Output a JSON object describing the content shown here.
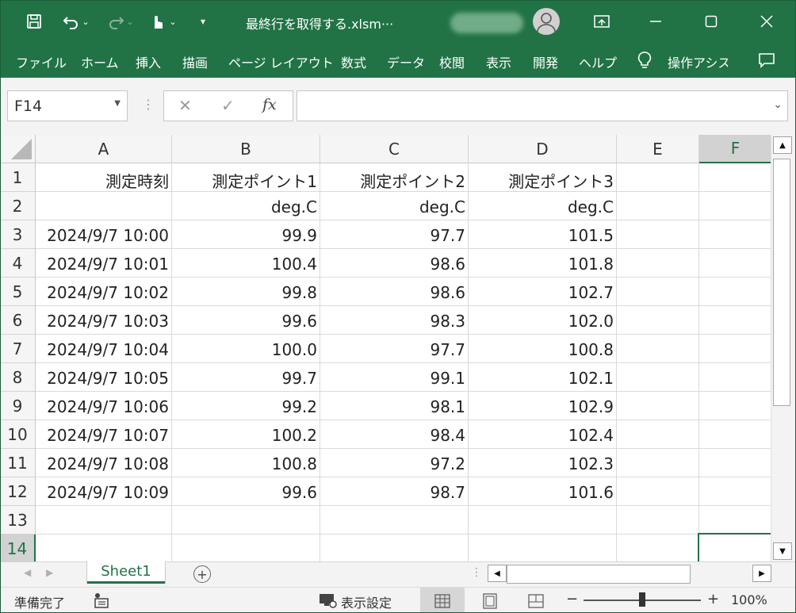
{
  "window": {
    "title": "最終行を取得する.xlsm···",
    "controls": [
      "restore-ribbon",
      "minimize",
      "maximize",
      "close"
    ]
  },
  "quick_access": {
    "icons": [
      "save-icon",
      "undo-icon",
      "redo-icon",
      "touch-mode-icon",
      "customize-icon"
    ]
  },
  "ribbon": {
    "tabs": [
      "ファイル",
      "ホーム",
      "挿入",
      "描画",
      "ページ レイアウト",
      "数式",
      "データ",
      "校閲",
      "表示",
      "開発",
      "ヘルプ"
    ],
    "tell_me": "操作アシス",
    "comments_icon": "comment-icon"
  },
  "formula_bar": {
    "name_box": "F14",
    "formula": "",
    "fx_label": "fx"
  },
  "columns": [
    "A",
    "B",
    "C",
    "D",
    "E",
    "F"
  ],
  "selected_column": "F",
  "selected_row": "14",
  "rows": [
    {
      "num": "1",
      "cells": [
        "測定時刻",
        "測定ポイント1",
        "測定ポイント2",
        "測定ポイント3",
        "",
        ""
      ]
    },
    {
      "num": "2",
      "cells": [
        "",
        "deg.C",
        "deg.C",
        "deg.C",
        "",
        ""
      ]
    },
    {
      "num": "3",
      "cells": [
        "2024/9/7 10:00",
        "99.9",
        "97.7",
        "101.5",
        "",
        ""
      ]
    },
    {
      "num": "4",
      "cells": [
        "2024/9/7 10:01",
        "100.4",
        "98.6",
        "101.8",
        "",
        ""
      ]
    },
    {
      "num": "5",
      "cells": [
        "2024/9/7 10:02",
        "99.8",
        "98.6",
        "102.7",
        "",
        ""
      ]
    },
    {
      "num": "6",
      "cells": [
        "2024/9/7 10:03",
        "99.6",
        "98.3",
        "102.0",
        "",
        ""
      ]
    },
    {
      "num": "7",
      "cells": [
        "2024/9/7 10:04",
        "100.0",
        "97.7",
        "100.8",
        "",
        ""
      ]
    },
    {
      "num": "8",
      "cells": [
        "2024/9/7 10:05",
        "99.7",
        "99.1",
        "102.1",
        "",
        ""
      ]
    },
    {
      "num": "9",
      "cells": [
        "2024/9/7 10:06",
        "99.2",
        "98.1",
        "102.9",
        "",
        ""
      ]
    },
    {
      "num": "10",
      "cells": [
        "2024/9/7 10:07",
        "100.2",
        "98.4",
        "102.4",
        "",
        ""
      ]
    },
    {
      "num": "11",
      "cells": [
        "2024/9/7 10:08",
        "100.8",
        "97.2",
        "102.3",
        "",
        ""
      ]
    },
    {
      "num": "12",
      "cells": [
        "2024/9/7 10:09",
        "99.6",
        "98.7",
        "101.6",
        "",
        ""
      ]
    },
    {
      "num": "13",
      "cells": [
        "",
        "",
        "",
        "",
        "",
        ""
      ]
    },
    {
      "num": "14",
      "cells": [
        "",
        "",
        "",
        "",
        "",
        ""
      ]
    }
  ],
  "sheets": [
    "Sheet1"
  ],
  "status": {
    "ready": "準備完了",
    "display_settings": "表示設定",
    "zoom": "100%",
    "zoom_minus": "−",
    "zoom_plus": "+"
  },
  "colors": {
    "brand": "#217346",
    "selection": "#217346"
  }
}
